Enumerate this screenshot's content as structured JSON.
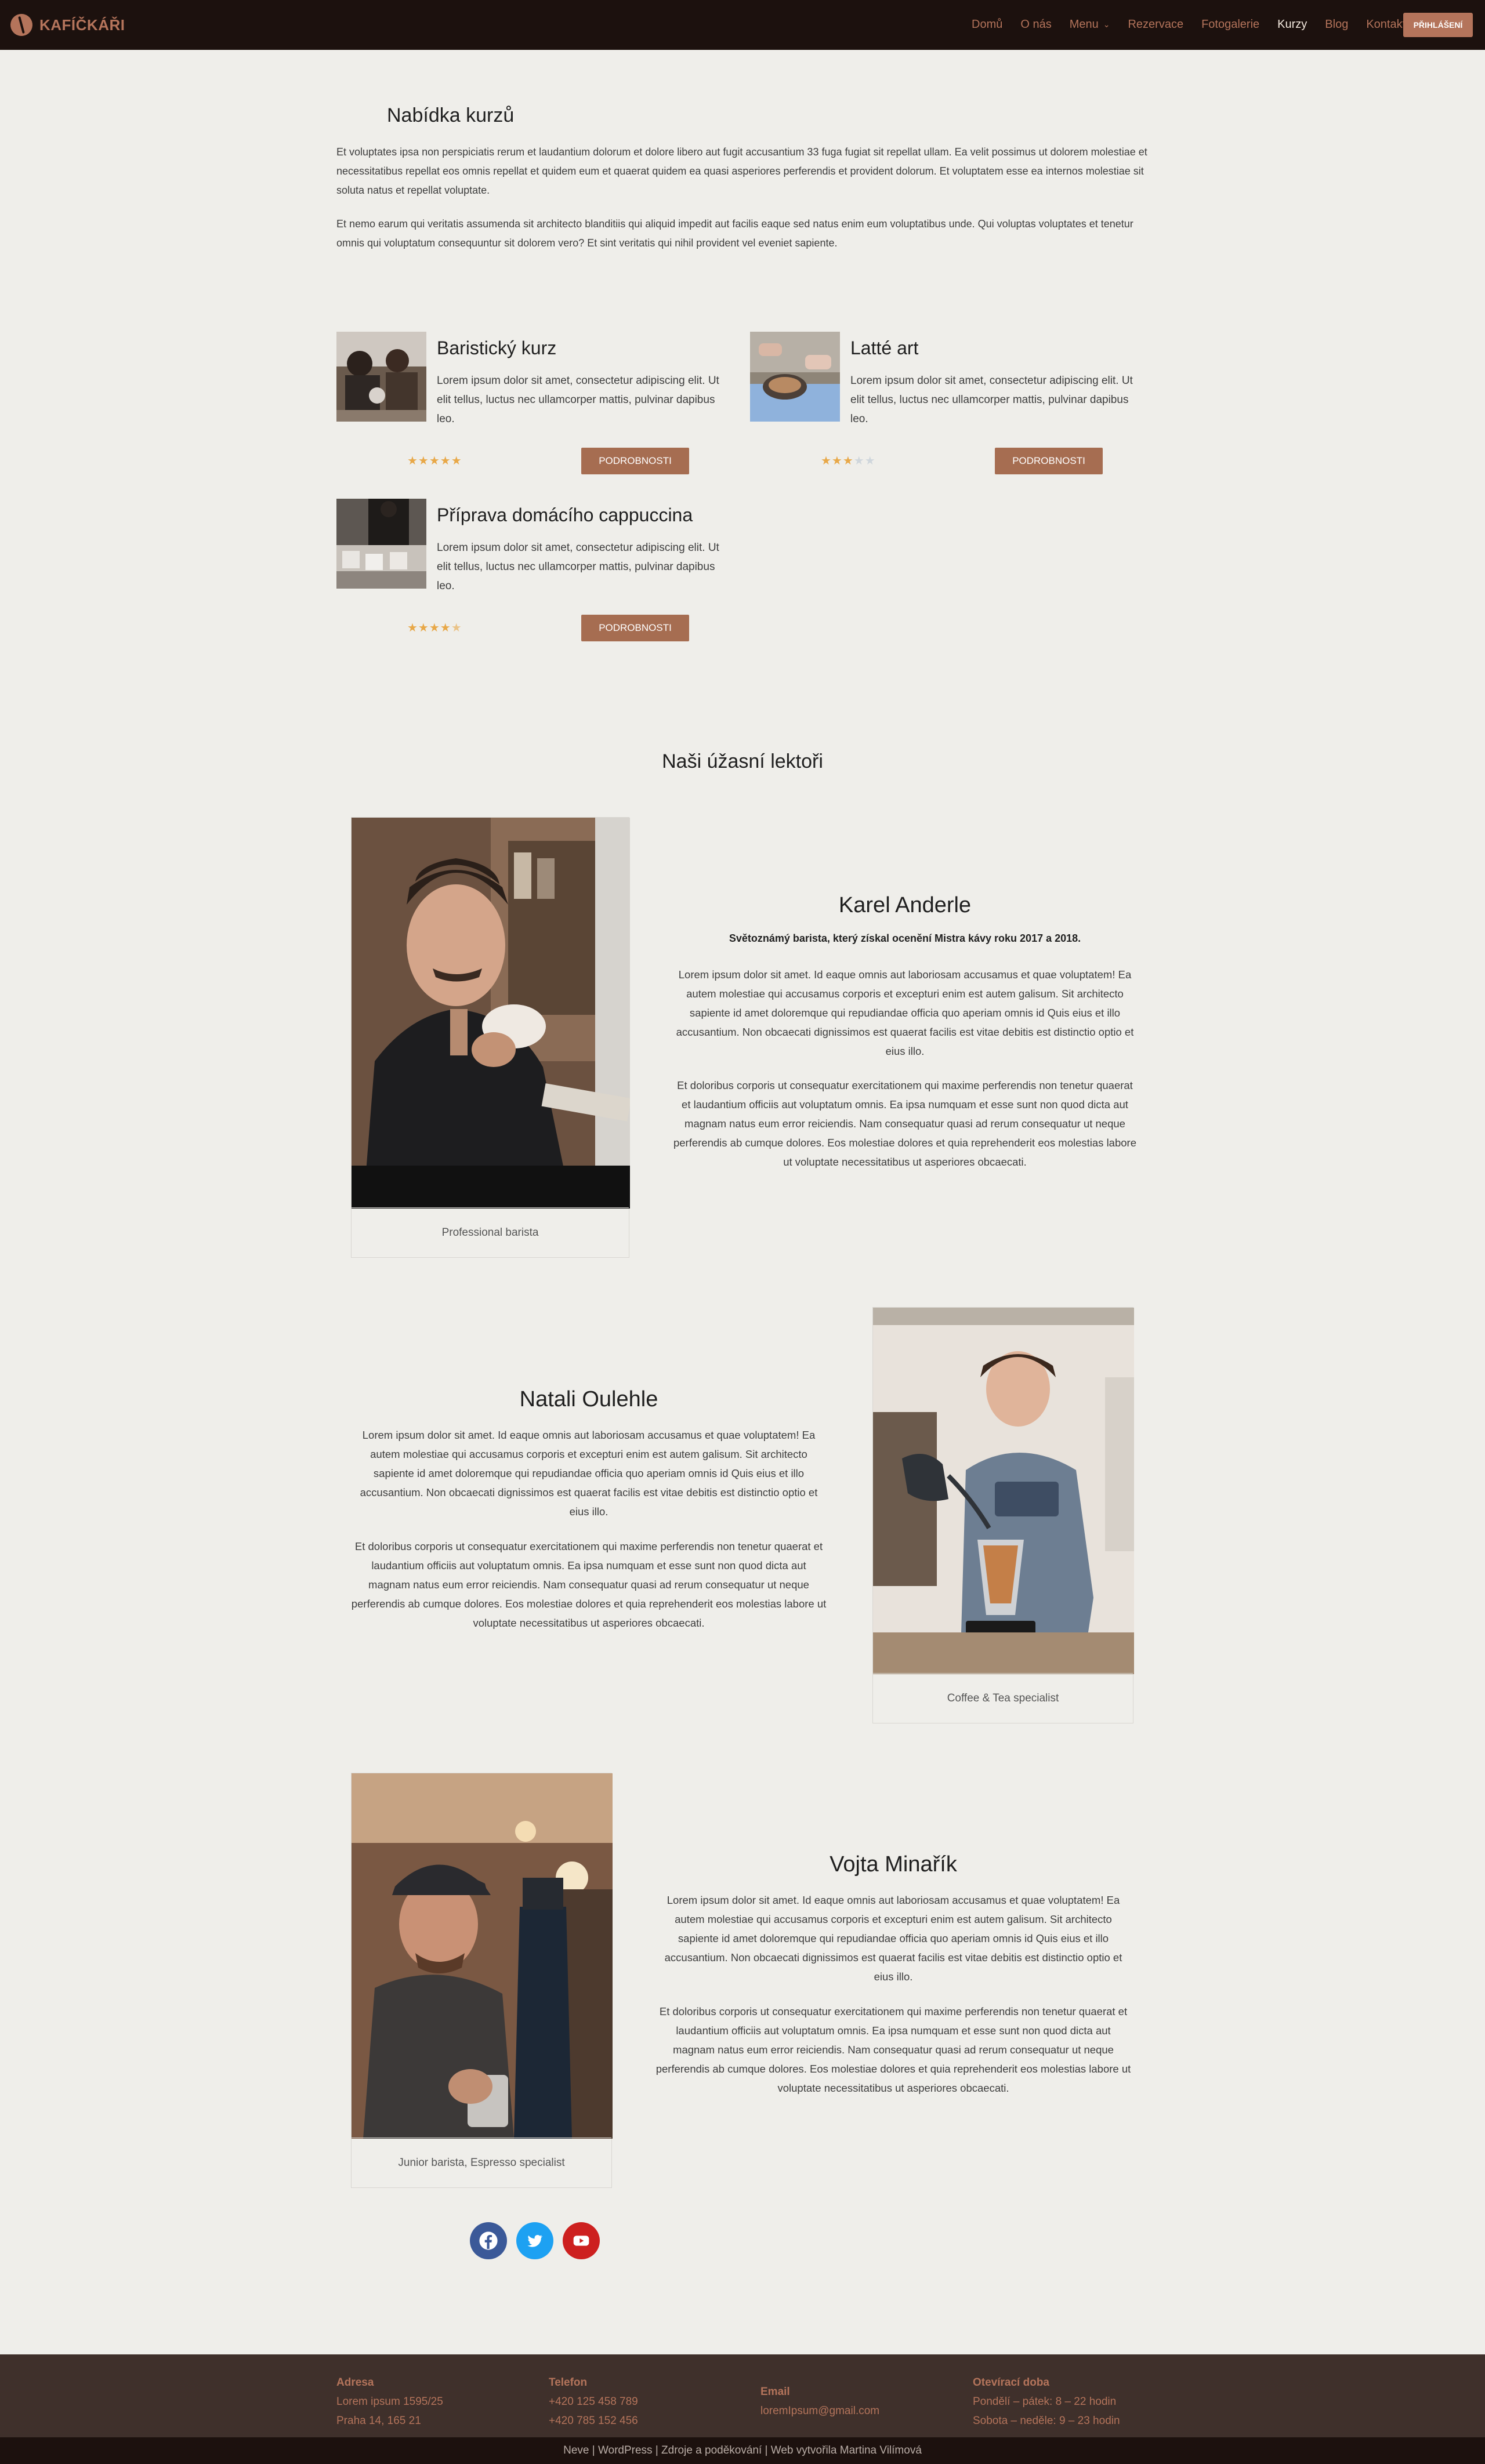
{
  "header": {
    "brand": "KAFÍČKÁŘI",
    "nav": [
      {
        "label": "Domů"
      },
      {
        "label": "O nás"
      },
      {
        "label": "Menu"
      },
      {
        "label": "Rezervace"
      },
      {
        "label": "Fotogalerie"
      },
      {
        "label": "Kurzy"
      },
      {
        "label": "Blog"
      },
      {
        "label": "Kontakt"
      }
    ],
    "active_nav": "Kurzy",
    "login": "PŘIHLÁŠENÍ"
  },
  "intro": {
    "title": "Nabídka kurzů",
    "p1": "Et voluptates ipsa non perspiciatis rerum et laudantium dolorum et dolore libero aut fugit accusantium 33 fuga fugiat sit repellat ullam. Ea velit possimus ut dolorem molestiae et necessitatibus repellat eos omnis repellat et quidem eum et quaerat quidem ea quasi asperiores perferendis et provident dolorum. Et voluptatem esse ea internos molestiae sit soluta natus et repellat voluptate.",
    "p2": "Et nemo earum qui veritatis assumenda sit architecto blanditiis qui aliquid impedit aut facilis eaque sed natus enim eum voluptatibus unde. Qui voluptas voluptates et tenetur omnis qui voluptatum consequuntur sit dolorem vero? Et sint veritatis qui nihil provident vel eveniet sapiente."
  },
  "courses": [
    {
      "title": "Baristický kurz",
      "desc": "Lorem ipsum dolor sit amet, consectetur adipiscing elit. Ut elit tellus, luctus nec ullamcorper mattis, pulvinar dapibus leo.",
      "rating": 5,
      "button": "PODROBNOSTI"
    },
    {
      "title": "Latté art",
      "desc": "Lorem ipsum dolor sit amet, consectetur adipiscing elit. Ut elit tellus, luctus nec ullamcorper mattis, pulvinar dapibus leo.",
      "rating": 3.5,
      "button": "PODROBNOSTI"
    },
    {
      "title": "Příprava domácího cappuccina",
      "desc": "Lorem ipsum dolor sit amet, consectetur adipiscing elit. Ut elit tellus, luctus nec ullamcorper mattis, pulvinar dapibus leo.",
      "rating": 4.5,
      "button": "PODROBNOSTI"
    }
  ],
  "lecturers_title": "Naši úžasní lektoři",
  "lecturers": [
    {
      "name": "Karel Anderle",
      "subtitle": "Světoznámý barista, který získal ocenění Mistra kávy roku 2017 a 2018.",
      "p1": "Lorem ipsum dolor sit amet. Id eaque omnis aut laboriosam accusamus et quae voluptatem! Ea autem molestiae qui accusamus corporis et excepturi enim est autem galisum. Sit architecto sapiente id amet doloremque qui repudiandae officia quo aperiam omnis id Quis eius et illo accusantium. Non obcaecati dignissimos est quaerat facilis est vitae debitis est distinctio optio et eius illo.",
      "p2": "Et doloribus corporis ut consequatur exercitationem qui maxime perferendis non tenetur quaerat et laudantium officiis aut voluptatum omnis. Ea ipsa numquam et esse sunt non quod dicta aut magnam natus eum error reiciendis. Nam consequatur quasi ad rerum consequatur ut neque perferendis ab cumque dolores. Eos molestiae dolores et quia reprehenderit eos molestias labore ut voluptate necessitatibus ut asperiores obcaecati.",
      "caption": "Professional barista"
    },
    {
      "name": "Natali Oulehle",
      "p1": "Lorem ipsum dolor sit amet. Id eaque omnis aut laboriosam accusamus et quae voluptatem! Ea autem molestiae qui accusamus corporis et excepturi enim est autem galisum. Sit architecto sapiente id amet doloremque qui repudiandae officia quo aperiam omnis id Quis eius et illo accusantium. Non obcaecati dignissimos est quaerat facilis est vitae debitis est distinctio optio et eius illo.",
      "p2": "Et doloribus corporis ut consequatur exercitationem qui maxime perferendis non tenetur quaerat et laudantium officiis aut voluptatum omnis. Ea ipsa numquam et esse sunt non quod dicta aut magnam natus eum error reiciendis. Nam consequatur quasi ad rerum consequatur ut neque perferendis ab cumque dolores. Eos molestiae dolores et quia reprehenderit eos molestias labore ut voluptate necessitatibus ut asperiores obcaecati.",
      "caption": "Coffee & Tea specialist"
    },
    {
      "name": "Vojta Minařík",
      "p1": "Lorem ipsum dolor sit amet. Id eaque omnis aut laboriosam accusamus et quae voluptatem! Ea autem molestiae qui accusamus corporis et excepturi enim est autem galisum. Sit architecto sapiente id amet doloremque qui repudiandae officia quo aperiam omnis id Quis eius et illo accusantium. Non obcaecati dignissimos est quaerat facilis est vitae debitis est distinctio optio et eius illo.",
      "p2": "Et doloribus corporis ut consequatur exercitationem qui maxime perferendis non tenetur quaerat et laudantium officiis aut voluptatum omnis. Ea ipsa numquam et esse sunt non quod dicta aut magnam natus eum error reiciendis. Nam consequatur quasi ad rerum consequatur ut neque perferendis ab cumque dolores. Eos molestiae dolores et quia reprehenderit eos molestias labore ut voluptate necessitatibus ut asperiores obcaecati.",
      "caption": "Junior barista, Espresso specialist"
    }
  ],
  "social": [
    {
      "icon": "facebook-icon",
      "color": "#3b5998"
    },
    {
      "icon": "twitter-icon",
      "color": "#1da1f2"
    },
    {
      "icon": "youtube-icon",
      "color": "#cd201f"
    }
  ],
  "footer": {
    "address_h": "Adresa",
    "address_1": "Lorem ipsum 1595/25",
    "address_2": "Praha 14, 165 21",
    "phone_h": "Telefon",
    "phone_1": "+420 125 458 789",
    "phone_2": "+420 785 152 456",
    "email_h": "Email",
    "email_1": "loremIpsum@gmail.com",
    "hours_h": "Otevírací doba",
    "hours_1": "Pondělí – pátek: 8 – 22 hodin",
    "hours_2": "Sobota – neděle: 9 – 23 hodin",
    "credits": "Neve | WordPress | Zdroje a poděkování | Web vytvořila Martina Vilímová"
  },
  "colors": {
    "accent": "#b4745b",
    "header_bg": "#1c110e",
    "page_bg": "#efeeea",
    "footer_bg": "#3f302b",
    "button": "#a66d51"
  }
}
